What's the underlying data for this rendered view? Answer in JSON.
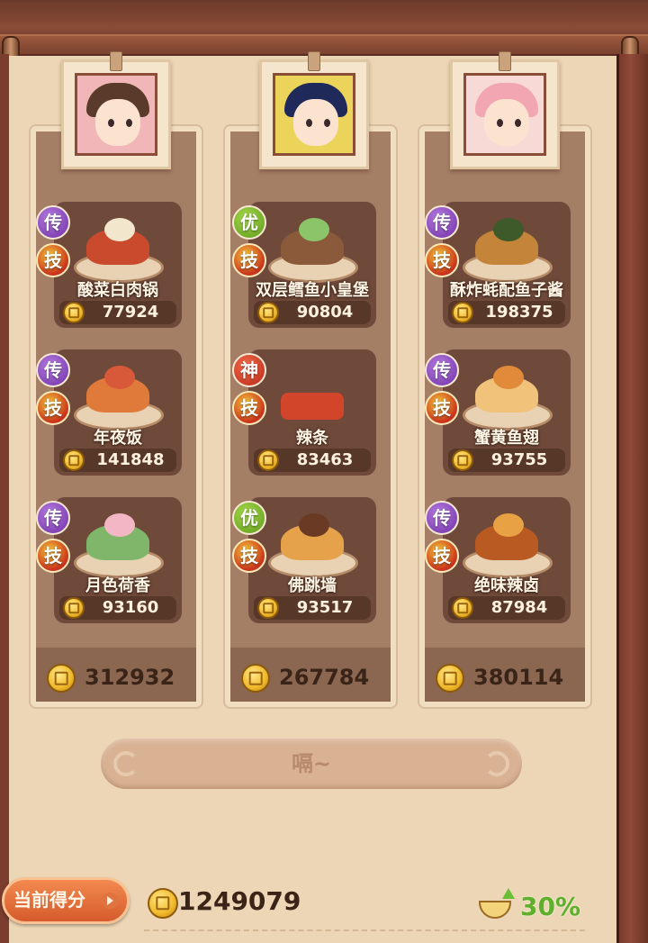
{
  "colors": {
    "legend_badge": "#7b36b0",
    "good_badge": "#6aa820",
    "god_badge": "#c8301c",
    "score_label_bg": "#e46c3a",
    "percent_green": "#5fae2c"
  },
  "columns": [
    {
      "portrait": "girl-with-magnifier-portrait",
      "total": "312932",
      "dishes": [
        {
          "grade": "传",
          "grade_type": "legend",
          "skill": "技",
          "name": "酸菜白肉锅",
          "price": "77924"
        },
        {
          "grade": "传",
          "grade_type": "legend",
          "skill": "技",
          "name": "年夜饭",
          "price": "141848"
        },
        {
          "grade": "传",
          "grade_type": "legend",
          "skill": "技",
          "name": "月色荷香",
          "price": "93160"
        }
      ]
    },
    {
      "portrait": "official-with-hat-portrait",
      "total": "267784",
      "dishes": [
        {
          "grade": "优",
          "grade_type": "good",
          "skill": "技",
          "name": "双层鳕鱼小皇堡",
          "price": "90804"
        },
        {
          "grade": "神",
          "grade_type": "god",
          "skill": "技",
          "name": "辣条",
          "price": "83463"
        },
        {
          "grade": "优",
          "grade_type": "good",
          "skill": "技",
          "name": "佛跳墙",
          "price": "93517"
        }
      ]
    },
    {
      "portrait": "pink-haired-girl-portrait",
      "total": "380114",
      "dishes": [
        {
          "grade": "传",
          "grade_type": "legend",
          "skill": "技",
          "name": "酥炸蚝配鱼子酱",
          "price": "198375"
        },
        {
          "grade": "传",
          "grade_type": "legend",
          "skill": "技",
          "name": "蟹黄鱼翅",
          "price": "93755"
        },
        {
          "grade": "传",
          "grade_type": "legend",
          "skill": "技",
          "name": "绝味辣卤",
          "price": "87984"
        }
      ]
    }
  ],
  "action_button": "嗝~",
  "score": {
    "label": "当前得分",
    "value": "1249079",
    "bonus_icon": "bowl-up-arrow-icon",
    "bonus": "30%"
  }
}
